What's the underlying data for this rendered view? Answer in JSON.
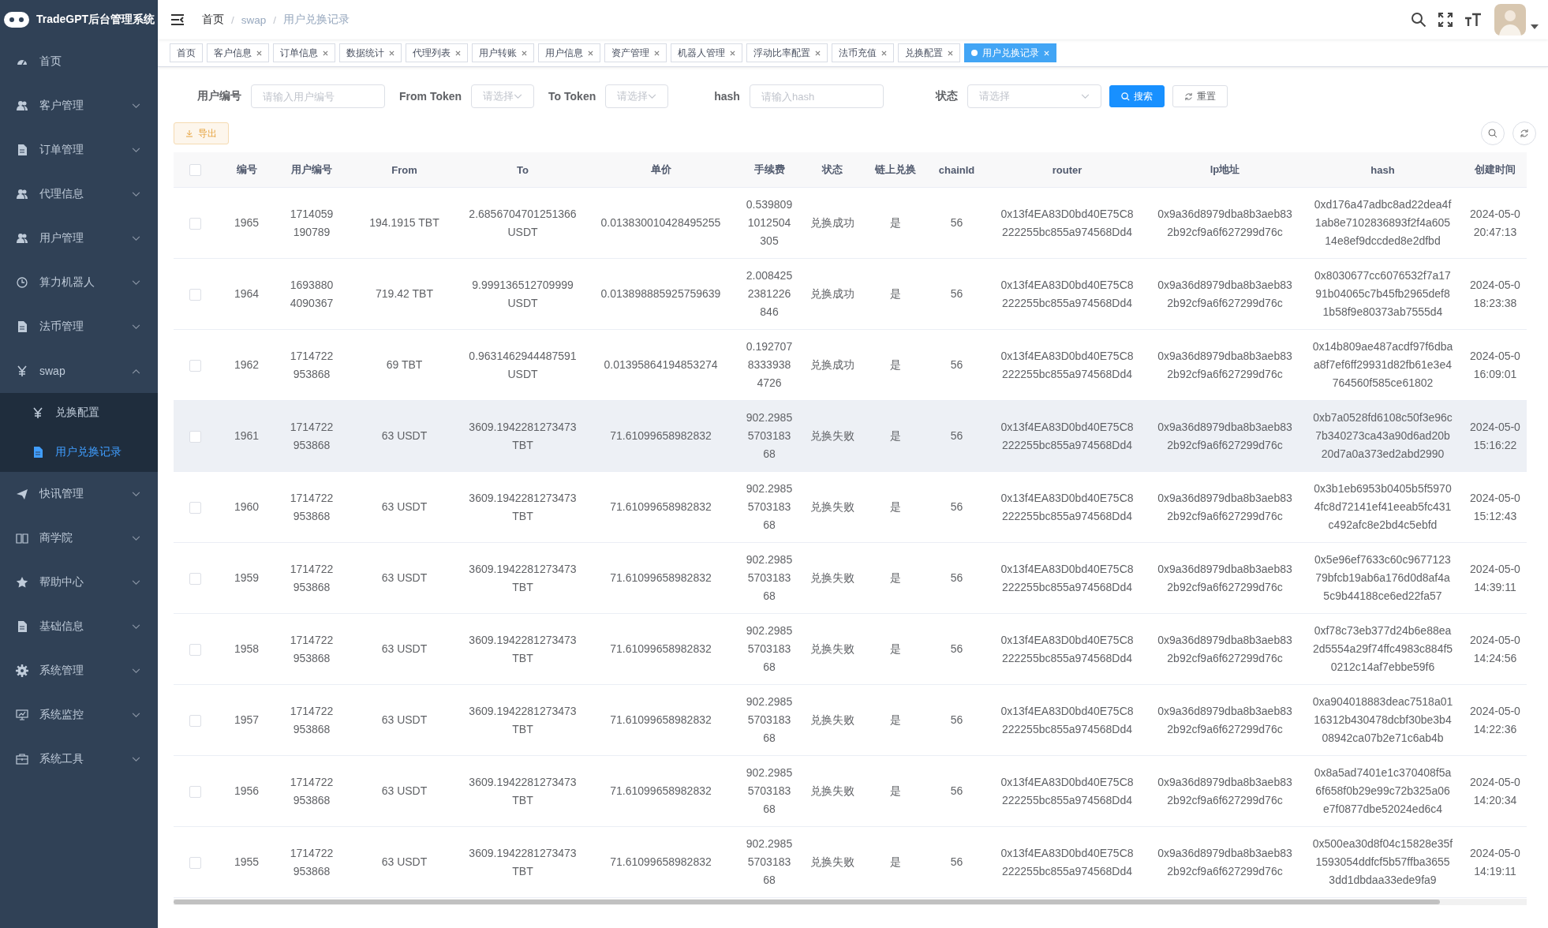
{
  "app": {
    "title": "TradeGPT后台管理系统"
  },
  "sidebar": {
    "items": [
      {
        "label": "首页"
      },
      {
        "label": "客户管理",
        "expanded": false
      },
      {
        "label": "订单管理",
        "expanded": false
      },
      {
        "label": "代理信息",
        "expanded": false
      },
      {
        "label": "用户管理",
        "expanded": false
      },
      {
        "label": "算力机器人",
        "expanded": false
      },
      {
        "label": "法币管理",
        "expanded": false
      },
      {
        "label": "swap",
        "expanded": true,
        "children": [
          {
            "label": "兑换配置",
            "selected": false
          },
          {
            "label": "用户兑换记录",
            "selected": true
          }
        ]
      },
      {
        "label": "快讯管理",
        "expanded": false
      },
      {
        "label": "商学院",
        "expanded": false
      },
      {
        "label": "帮助中心",
        "expanded": false
      },
      {
        "label": "基础信息",
        "expanded": false
      },
      {
        "label": "系统管理",
        "expanded": false
      },
      {
        "label": "系统监控",
        "expanded": false
      },
      {
        "label": "系统工具",
        "expanded": false
      }
    ]
  },
  "breadcrumb": [
    {
      "label": "首页"
    },
    {
      "separator": "/",
      "label": "swap"
    },
    {
      "separator": "/",
      "label": "用户兑换记录"
    }
  ],
  "tabs": [
    {
      "label": "首页",
      "closable": false,
      "selected": false
    },
    {
      "label": "客户信息",
      "closable": true,
      "selected": false
    },
    {
      "label": "订单信息",
      "closable": true,
      "selected": false
    },
    {
      "label": "数据统计",
      "closable": true,
      "selected": false
    },
    {
      "label": "代理列表",
      "closable": true,
      "selected": false
    },
    {
      "label": "用户转账",
      "closable": true,
      "selected": false
    },
    {
      "label": "用户信息",
      "closable": true,
      "selected": false
    },
    {
      "label": "资产管理",
      "closable": true,
      "selected": false
    },
    {
      "label": "机器人管理",
      "closable": true,
      "selected": false
    },
    {
      "label": "浮动比率配置",
      "closable": true,
      "selected": false
    },
    {
      "label": "法币充值",
      "closable": true,
      "selected": false
    },
    {
      "label": "兑换配置",
      "closable": true,
      "selected": false
    },
    {
      "label": "用户兑换记录",
      "closable": true,
      "selected": true
    }
  ],
  "filters": [
    {
      "label": "用户编号",
      "kind": "input",
      "placeholder": "请输入用户编号"
    },
    {
      "label": "From Token",
      "kind": "select",
      "placeholder": "请选择"
    },
    {
      "label": "To Token",
      "kind": "select",
      "placeholder": "请选择"
    },
    {
      "label": "hash",
      "kind": "input",
      "placeholder": "请输入hash"
    },
    {
      "label": "状态",
      "kind": "select",
      "placeholder": "请选择"
    }
  ],
  "buttons": [
    {
      "label": "搜索",
      "kind": "primary"
    },
    {
      "label": "重置",
      "kind": "default"
    }
  ],
  "export_button": "导出",
  "table": {
    "select_all_checked": false,
    "columns": [
      "编号",
      "用户编号",
      "From",
      "To",
      "单价",
      "手续费",
      "状态",
      "链上兑换",
      "chainId",
      "router",
      "lp地址",
      "hash",
      "创建时间"
    ],
    "rows": [
      {
        "checked": false,
        "highlighted": false,
        "cells": [
          "1965",
          "1714059190789",
          "194.1915 TBT",
          "2.6856704701251366 USDT",
          "0.013830010428495255",
          "0.5398091012504305",
          "兑换成功",
          "是",
          "56",
          "0x13f4EA83D0bd40E75C8222255bc855a974568Dd4",
          "0x9a36d8979dba8b3aeb832b92cf9a6f627299d76c",
          "0xd176a47adbc8ad22dea4f1ab8e7102836893f2f4a60514e8ef9dccded8e2dfbd",
          "2024-05-0\n20:47:13"
        ]
      },
      {
        "checked": false,
        "highlighted": false,
        "cells": [
          "1964",
          "16938804090367",
          "719.42 TBT",
          "9.999136512709999 USDT",
          "0.013898885925759639",
          "2.0084252381226846",
          "兑换成功",
          "是",
          "56",
          "0x13f4EA83D0bd40E75C8222255bc855a974568Dd4",
          "0x9a36d8979dba8b3aeb832b92cf9a6f627299d76c",
          "0x8030677cc6076532f7a1791b04065c7b45fb2965def81b58f9e80373ab7555d4",
          "2024-05-0\n18:23:38"
        ]
      },
      {
        "checked": false,
        "highlighted": false,
        "cells": [
          "1962",
          "1714722953868",
          "69 TBT",
          "0.9631462944487591 USDT",
          "0.01395864194853274",
          "0.19270783339384726",
          "兑换成功",
          "是",
          "56",
          "0x13f4EA83D0bd40E75C8222255bc855a974568Dd4",
          "0x9a36d8979dba8b3aeb832b92cf9a6f627299d76c",
          "0x14b809ae487acdf97f6dbaa8f7ef6ff29931d82fb61e3e4764560f585ce61802",
          "2024-05-0\n16:09:01"
        ]
      },
      {
        "checked": false,
        "highlighted": true,
        "cells": [
          "1961",
          "1714722953868",
          "63 USDT",
          "3609.1942281273473 TBT",
          "71.61099658982832",
          "902.2985570318368",
          "兑换失败",
          "是",
          "56",
          "0x13f4EA83D0bd40E75C8222255bc855a974568Dd4",
          "0x9a36d8979dba8b3aeb832b92cf9a6f627299d76c",
          "0xb7a0528fd6108c50f3e96c7b340273ca43a90d6ad20b20d7a0a373ed2abd2990",
          "2024-05-0\n15:16:22"
        ]
      },
      {
        "checked": false,
        "highlighted": false,
        "cells": [
          "1960",
          "1714722953868",
          "63 USDT",
          "3609.1942281273473 TBT",
          "71.61099658982832",
          "902.2985570318368",
          "兑换失败",
          "是",
          "56",
          "0x13f4EA83D0bd40E75C8222255bc855a974568Dd4",
          "0x9a36d8979dba8b3aeb832b92cf9a6f627299d76c",
          "0x3b1eb6953b0405b5f59704fc8d72141ef41eeab5fc431c492afc8e2bd4c5ebfd",
          "2024-05-0\n15:12:43"
        ]
      },
      {
        "checked": false,
        "highlighted": false,
        "cells": [
          "1959",
          "1714722953868",
          "63 USDT",
          "3609.1942281273473 TBT",
          "71.61099658982832",
          "902.2985570318368",
          "兑换失败",
          "是",
          "56",
          "0x13f4EA83D0bd40E75C8222255bc855a974568Dd4",
          "0x9a36d8979dba8b3aeb832b92cf9a6f627299d76c",
          "0x5e96ef7633c60c967712379bfcb19ab6a176d0d8af4a5c9b44188ce6ed22fa57",
          "2024-05-0\n14:39:11"
        ]
      },
      {
        "checked": false,
        "highlighted": false,
        "cells": [
          "1958",
          "1714722953868",
          "63 USDT",
          "3609.1942281273473 TBT",
          "71.61099658982832",
          "902.2985570318368",
          "兑换失败",
          "是",
          "56",
          "0x13f4EA83D0bd40E75C8222255bc855a974568Dd4",
          "0x9a36d8979dba8b3aeb832b92cf9a6f627299d76c",
          "0xf78c73eb377d24b6e88ea2d5554a29f74ffc4983c884f50212c14af7ebbe59f6",
          "2024-05-0\n14:24:56"
        ]
      },
      {
        "checked": false,
        "highlighted": false,
        "cells": [
          "1957",
          "1714722953868",
          "63 USDT",
          "3609.1942281273473 TBT",
          "71.61099658982832",
          "902.2985570318368",
          "兑换失败",
          "是",
          "56",
          "0x13f4EA83D0bd40E75C8222255bc855a974568Dd4",
          "0x9a36d8979dba8b3aeb832b92cf9a6f627299d76c",
          "0xa904018883deac7518a0116312b430478dcbf30be3b408942ca07b2e71c6ab4b",
          "2024-05-0\n14:22:36"
        ]
      },
      {
        "checked": false,
        "highlighted": false,
        "cells": [
          "1956",
          "1714722953868",
          "63 USDT",
          "3609.1942281273473 TBT",
          "71.61099658982832",
          "902.2985570318368",
          "兑换失败",
          "是",
          "56",
          "0x13f4EA83D0bd40E75C8222255bc855a974568Dd4",
          "0x9a36d8979dba8b3aeb832b92cf9a6f627299d76c",
          "0x8a5ad7401e1c370408f5a6f658f0b29e99c72b325a06e7f0877dbe52024ed6c4",
          "2024-05-0\n14:20:34"
        ]
      },
      {
        "checked": false,
        "highlighted": false,
        "cells": [
          "1955",
          "1714722953868",
          "63 USDT",
          "3609.1942281273473 TBT",
          "71.61099658982832",
          "902.2985570318368",
          "兑换失败",
          "是",
          "56",
          "0x13f4EA83D0bd40E75C8222255bc855a974568Dd4",
          "0x9a36d8979dba8b3aeb832b92cf9a6f627299d76c",
          "0x500ea30d8f04c15828e35f1593054ddfcf5b57ffba36553dd1dbdaa33ede9fa9",
          "2024-05-0\n14:19:11"
        ]
      }
    ]
  }
}
